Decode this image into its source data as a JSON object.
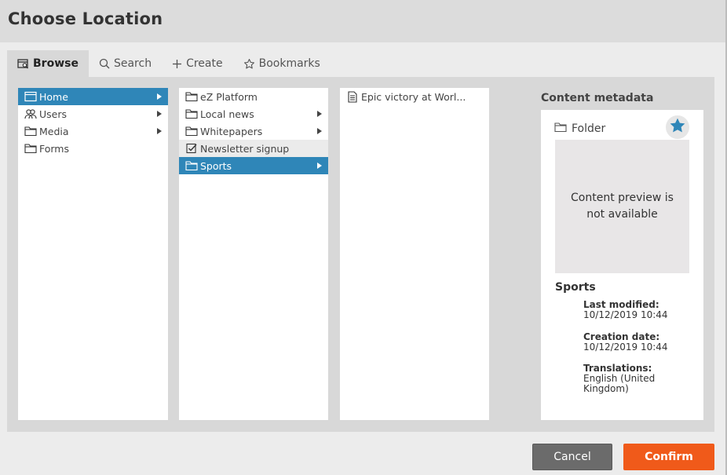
{
  "dialog": {
    "title": "Choose Location"
  },
  "tabs": [
    {
      "label": "Browse",
      "icon": "browse-icon",
      "active": true
    },
    {
      "label": "Search",
      "icon": "search-icon",
      "active": false
    },
    {
      "label": "Create",
      "icon": "plus-icon",
      "active": false
    },
    {
      "label": "Bookmarks",
      "icon": "star-outline-icon",
      "active": false
    }
  ],
  "columns": [
    {
      "items": [
        {
          "label": "Home",
          "icon": "home-folder-icon",
          "selected": true,
          "has_children": true
        },
        {
          "label": "Users",
          "icon": "users-icon",
          "selected": false,
          "has_children": true
        },
        {
          "label": "Media",
          "icon": "folder-icon",
          "selected": false,
          "has_children": true
        },
        {
          "label": "Forms",
          "icon": "folder-icon",
          "selected": false,
          "has_children": false
        }
      ]
    },
    {
      "items": [
        {
          "label": "eZ Platform",
          "icon": "folder-icon",
          "selected": false,
          "has_children": false
        },
        {
          "label": "Local news",
          "icon": "folder-icon",
          "selected": false,
          "has_children": true
        },
        {
          "label": "Whitepapers",
          "icon": "folder-icon",
          "selected": false,
          "has_children": true
        },
        {
          "label": "Newsletter signup",
          "icon": "checkbox-form-icon",
          "selected": false,
          "has_children": false,
          "hovered": true
        },
        {
          "label": "Sports",
          "icon": "folder-icon",
          "selected": true,
          "has_children": true
        }
      ]
    },
    {
      "items": [
        {
          "label": "Epic victory at Worl...",
          "icon": "article-icon",
          "selected": false,
          "has_children": false
        }
      ]
    }
  ],
  "metadata": {
    "heading": "Content metadata",
    "content_type": "Folder",
    "preview_text": "Content preview is not available",
    "name": "Sports",
    "fields": [
      {
        "label": "Last modified:",
        "value": "10/12/2019 10:44"
      },
      {
        "label": "Creation date:",
        "value": "10/12/2019 10:44"
      },
      {
        "label": "Translations:",
        "value": "English (United Kingdom)"
      }
    ],
    "bookmark_icon": "star-filled-icon"
  },
  "actions": {
    "cancel_label": "Cancel",
    "confirm_label": "Confirm"
  },
  "colors": {
    "selected": "#2f86b8",
    "confirm": "#f05a1a",
    "cancel": "#6b6b6b",
    "star": "#2f86b8"
  }
}
